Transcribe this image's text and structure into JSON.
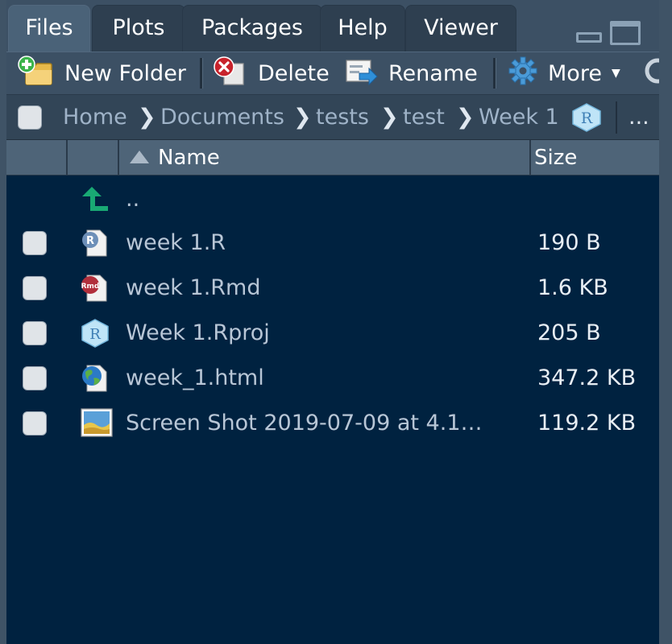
{
  "tabs": [
    {
      "label": "Files",
      "active": true
    },
    {
      "label": "Plots",
      "active": false
    },
    {
      "label": "Packages",
      "active": false
    },
    {
      "label": "Help",
      "active": false
    },
    {
      "label": "Viewer",
      "active": false
    }
  ],
  "toolbar": {
    "new_folder": "New Folder",
    "delete": "Delete",
    "rename": "Rename",
    "more": "More"
  },
  "breadcrumb": {
    "items": [
      "Home",
      "Documents",
      "tests",
      "test",
      "Week 1"
    ],
    "overflow": "..."
  },
  "columns": {
    "name": "Name",
    "size": "Size"
  },
  "parent_link": "..",
  "files": [
    {
      "name": "week 1.R",
      "size": "190 B",
      "icon": "r-script-icon"
    },
    {
      "name": "week 1.Rmd",
      "size": "1.6 KB",
      "icon": "rmarkdown-icon"
    },
    {
      "name": "Week 1.Rproj",
      "size": "205 B",
      "icon": "rproj-icon"
    },
    {
      "name": "week_1.html",
      "size": "347.2 KB",
      "icon": "html-globe-icon"
    },
    {
      "name": "Screen Shot 2019-07-09 at 4.1…",
      "size": "119.2 KB",
      "icon": "image-file-icon"
    }
  ],
  "colors": {
    "pane_bg": "#002240",
    "toolbar_bg": "#3c5064",
    "file_name_text": "#b8c6d6",
    "size_text": "#e8eef4",
    "parent_arrow": "#19a974"
  }
}
